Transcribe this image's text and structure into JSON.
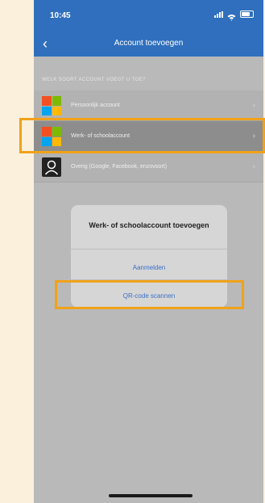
{
  "status_bar": {
    "time": "10:45"
  },
  "nav": {
    "title": "Account toevoegen"
  },
  "section_header": "WELK SOORT ACCOUNT VOEGT U TOE?",
  "accounts": [
    {
      "label": "Persoonlijk account",
      "icon": "microsoft-icon"
    },
    {
      "label": "Werk- of schoolaccount",
      "icon": "microsoft-icon"
    },
    {
      "label": "Overig (Google, Facebook, enzovoort)",
      "icon": "person-icon"
    }
  ],
  "dialog": {
    "title": "Werk- of schoolaccount toevoegen",
    "sign_in": "Aanmelden",
    "scan_qr": "QR-code scannen"
  },
  "colors": {
    "nav_blue": "#2f6fbd",
    "highlight_orange": "#f0a21a",
    "link_blue": "#3a6fc8",
    "ms_red": "#f25022",
    "ms_green": "#7fba00",
    "ms_blue": "#00a4ef",
    "ms_yellow": "#ffb900"
  }
}
